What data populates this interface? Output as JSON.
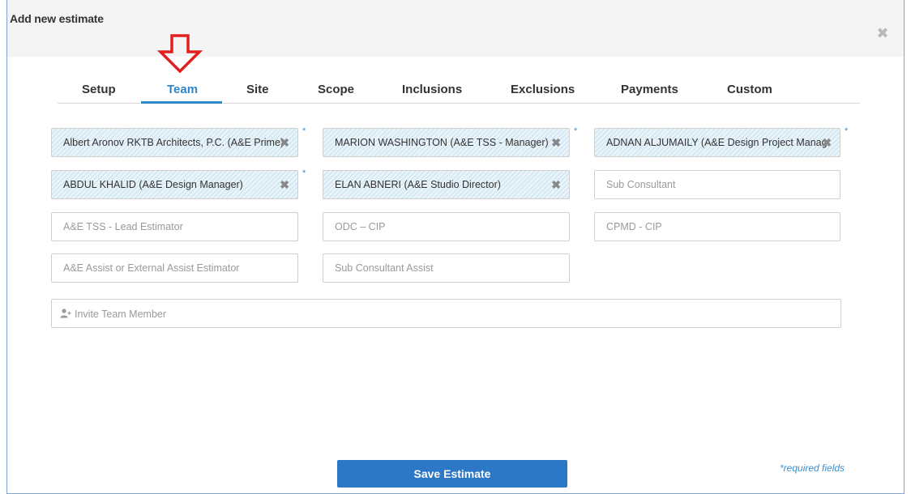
{
  "modal": {
    "title": "Add new estimate",
    "close_glyph": "✖"
  },
  "tabs": [
    {
      "label": "Setup"
    },
    {
      "label": "Team"
    },
    {
      "label": "Site"
    },
    {
      "label": "Scope"
    },
    {
      "label": "Inclusions"
    },
    {
      "label": "Exclusions"
    },
    {
      "label": "Payments"
    },
    {
      "label": "Custom"
    }
  ],
  "active_tab": "Team",
  "team": {
    "prime": {
      "value": "Albert Aronov RKTB Architects, P.C. (A&E Prime)",
      "required_mark": "*"
    },
    "tss_manager": {
      "value": "MARION WASHINGTON (A&E TSS - Manager)",
      "required_mark": "*"
    },
    "design_project_manager": {
      "value": "ADNAN ALJUMAILY (A&E Design Project Manager)",
      "required_mark": "*"
    },
    "design_manager": {
      "value": "ABDUL KHALID (A&E Design Manager)",
      "required_mark": "*"
    },
    "studio_director": {
      "value": "ELAN ABNERI (A&E Studio Director)"
    },
    "sub_consultant": {
      "placeholder": "Sub Consultant"
    },
    "lead_estimator": {
      "placeholder": "A&E TSS - Lead Estimator"
    },
    "odc_cip": {
      "placeholder": "ODC – CIP"
    },
    "cpmd_cip": {
      "placeholder": "CPMD - CIP"
    },
    "assist_estimator": {
      "placeholder": "A&E Assist or External Assist Estimator"
    },
    "sub_consultant_assist": {
      "placeholder": "Sub Consultant Assist"
    },
    "remove_glyph": "✖"
  },
  "invite": {
    "label": "Invite Team Member",
    "icon": "add-user-icon"
  },
  "footer": {
    "save_label": "Save Estimate",
    "required_note": "*required fields"
  },
  "colors": {
    "accent": "#2f86c8",
    "save_button": "#2c78c6",
    "arrow": "#e02020"
  }
}
